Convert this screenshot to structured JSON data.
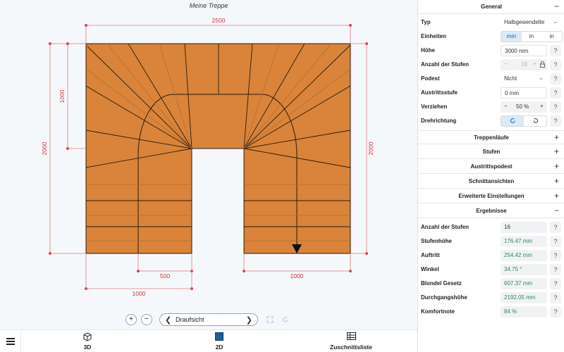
{
  "drawing": {
    "title": "Meine Treppe",
    "dimensions": {
      "top_width": "2500",
      "left_total": "2000",
      "left_upper": "1000",
      "right_total": "2000",
      "bottom_inner": "500",
      "bottom_left": "1000",
      "bottom_right": "1000"
    }
  },
  "view_controls": {
    "zoom_in": "+",
    "zoom_out": "−",
    "view_label": "Draufsicht",
    "prev_arrow": "❮",
    "next_arrow": "❯"
  },
  "bottom_bar": {
    "tabs": [
      {
        "label": "3D",
        "icon": "cube-icon"
      },
      {
        "label": "2D",
        "icon": "square-icon"
      },
      {
        "label": "Zuschnittsliste",
        "icon": "table-icon"
      }
    ]
  },
  "panel": {
    "general": {
      "title": "General",
      "toggle": "−",
      "typ_label": "Typ",
      "typ_value": "Halbgewendelte",
      "einheiten_label": "Einheiten",
      "einheiten_options": [
        "mm",
        "in",
        "in"
      ],
      "hoehe_label": "Höhe",
      "hoehe_value": "3000 mm",
      "stufen_label": "Anzahl der Stufen",
      "stufen_value": "16",
      "podest_label": "Podest",
      "podest_value": "Nicht",
      "austritt_label": "Austrittsstufe",
      "austritt_value": "0 mm",
      "verziehen_label": "Verziehen",
      "verziehen_value": "50 %",
      "drehrichtung_label": "Drehrichtung"
    },
    "collapsed_sections": [
      {
        "title": "Treppenläufe",
        "toggle": "+"
      },
      {
        "title": "Stufen",
        "toggle": "+"
      },
      {
        "title": "Austrittspodest",
        "toggle": "+"
      },
      {
        "title": "Schnittansichten",
        "toggle": "+"
      },
      {
        "title": "Erweiterte Einstellungen",
        "toggle": "+"
      }
    ],
    "results": {
      "title": "Ergebnisse",
      "toggle": "−",
      "rows": [
        {
          "label": "Anzahl der Stufen",
          "value": "16"
        },
        {
          "label": "Stufenhöhe",
          "value": "176.47 mm"
        },
        {
          "label": "Auftritt",
          "value": "254.42 mm"
        },
        {
          "label": "Winkel",
          "value": "34.75 °"
        },
        {
          "label": "Blondel Gesetz",
          "value": "607.37 mm"
        },
        {
          "label": "Durchgangshöhe",
          "value": "2192.05 mm"
        },
        {
          "label": "Komfortnote",
          "value": "84 %"
        }
      ]
    },
    "help": "?"
  },
  "colors": {
    "wood": "#d9843a",
    "dimension": "#d9434a",
    "accent": "#1d5f9c",
    "result_value": "#2e8a53"
  }
}
